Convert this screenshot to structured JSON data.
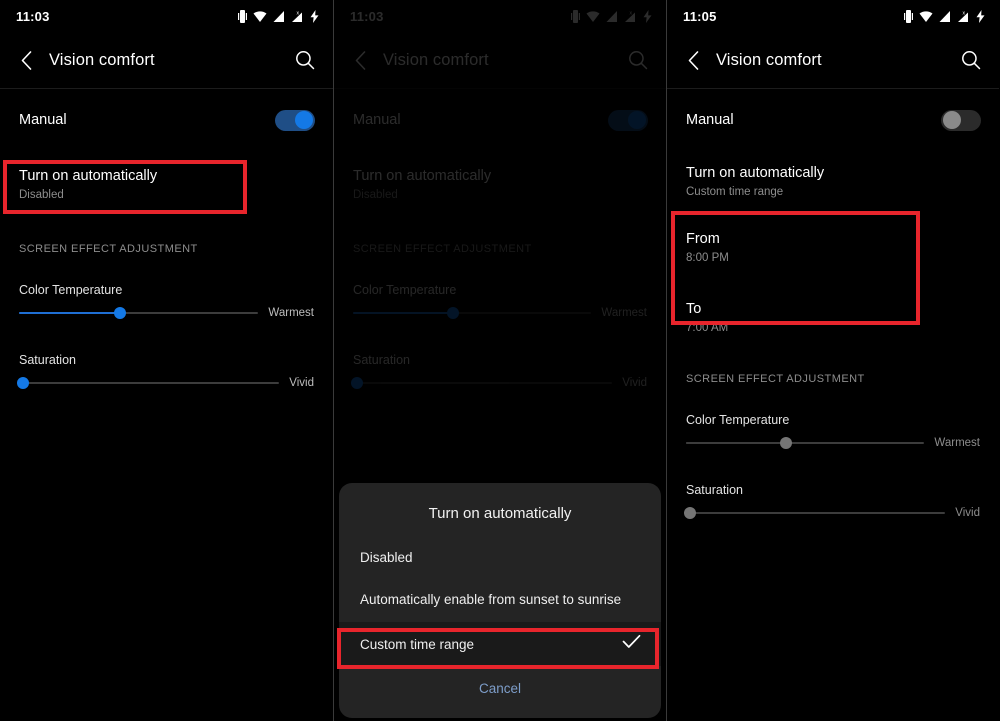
{
  "panels": [
    {
      "id": "panel-1",
      "statusbar": {
        "time": "11:03",
        "icons": [
          "vibrate-icon",
          "wifi-icon",
          "signal-icon",
          "signal-alt-icon",
          "charging-bolt-icon"
        ]
      },
      "appbar": {
        "back": "back-arrow-icon",
        "title": "Vision comfort",
        "search": "search-icon"
      },
      "manual": {
        "label": "Manual",
        "toggle_state": "on"
      },
      "auto": {
        "title": "Turn on automatically",
        "subtitle": "Disabled"
      },
      "section_header": "SCREEN EFFECT ADJUSTMENT",
      "sliders": [
        {
          "label": "Color Temperature",
          "end_label": "Warmest",
          "value": 42,
          "state": "active"
        },
        {
          "label": "Saturation",
          "end_label": "Vivid",
          "value": 0,
          "state": "active"
        }
      ],
      "highlight": "turn-on-automatically-row"
    },
    {
      "id": "panel-2",
      "statusbar": {
        "time": "11:03",
        "icons": [
          "vibrate-icon",
          "wifi-icon",
          "signal-icon",
          "signal-alt-icon",
          "charging-bolt-icon"
        ]
      },
      "appbar": {
        "back": "back-arrow-icon",
        "title": "Vision comfort",
        "search": "search-icon"
      },
      "manual": {
        "label": "Manual",
        "toggle_state": "on"
      },
      "auto": {
        "title": "Turn on automatically",
        "subtitle": "Disabled"
      },
      "section_header": "SCREEN EFFECT ADJUSTMENT",
      "sliders": [
        {
          "label": "Color Temperature",
          "end_label": "Warmest",
          "value": 42,
          "state": "active"
        },
        {
          "label": "Saturation",
          "end_label": "Vivid",
          "value": 0,
          "state": "active"
        }
      ],
      "dialog": {
        "title": "Turn on automatically",
        "options": [
          {
            "label": "Disabled",
            "selected": false
          },
          {
            "label": "Automatically enable from sunset to sunrise",
            "selected": false
          },
          {
            "label": "Custom time range",
            "selected": true
          }
        ],
        "cancel": "Cancel",
        "check_icon": "check-icon",
        "highlight": "custom-time-range-option"
      }
    },
    {
      "id": "panel-3",
      "statusbar": {
        "time": "11:05",
        "icons": [
          "vibrate-icon",
          "wifi-icon",
          "signal-icon",
          "signal-alt-icon",
          "charging-bolt-icon"
        ]
      },
      "appbar": {
        "back": "back-arrow-icon",
        "title": "Vision comfort",
        "search": "search-icon"
      },
      "manual": {
        "label": "Manual",
        "toggle_state": "off"
      },
      "auto": {
        "title": "Turn on automatically",
        "subtitle": "Custom time range"
      },
      "time_range": {
        "from": {
          "title": "From",
          "value": "8:00 PM"
        },
        "to": {
          "title": "To",
          "value": "7:00 AM"
        }
      },
      "section_header": "SCREEN EFFECT ADJUSTMENT",
      "sliders": [
        {
          "label": "Color Temperature",
          "end_label": "Warmest",
          "value": 42,
          "state": "inactive"
        },
        {
          "label": "Saturation",
          "end_label": "Vivid",
          "value": 0,
          "state": "inactive"
        }
      ],
      "highlight": "time-range-rows"
    }
  ],
  "colors": {
    "background": "#000000",
    "accent_blue": "#1479e6",
    "highlight_red": "#e8252c",
    "dialog_bg": "#242424",
    "cancel_blue": "#7d9dc9",
    "secondary_text": "#8d8d8d"
  }
}
